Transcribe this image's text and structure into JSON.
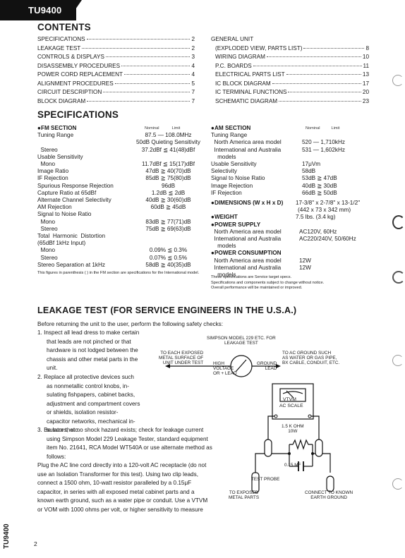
{
  "header": {
    "model_tab": "TU9400"
  },
  "contents": {
    "title": "CONTENTS",
    "left": [
      {
        "label": "SPECIFICATIONS",
        "page": "2"
      },
      {
        "label": "LEAKAGE TEST",
        "page": "2"
      },
      {
        "label": "CONTROLS & DISPLAYS",
        "page": "3"
      },
      {
        "label": "DISASSEMBLY PROCEDURES",
        "page": "4"
      },
      {
        "label": "POWER CORD REPLACEMENT",
        "page": "4"
      },
      {
        "label": "ALIGNMENT PROCEDURES",
        "page": "5"
      },
      {
        "label": "CIRCUIT DESCRIPTION",
        "page": "7"
      },
      {
        "label": "BLOCK DIAGRAM",
        "page": "7"
      }
    ],
    "right_first_line": "GENERAL UNIT",
    "right": [
      {
        "label": "(EXPLODED VIEW, PARTS LIST)",
        "page": "8"
      },
      {
        "label": "WIRING DIAGRAM",
        "page": "10"
      },
      {
        "label": "P.C. BOARDS",
        "page": "11"
      },
      {
        "label": "ELECTRICAL PARTS LIST",
        "page": "13"
      },
      {
        "label": "IC BLOCK DIAGRAM",
        "page": "17"
      },
      {
        "label": "IC TERMINAL FUNCTIONS",
        "page": "20"
      },
      {
        "label": "SCHEMATIC DIAGRAM",
        "page": "23"
      }
    ]
  },
  "specifications": {
    "title": "SPECIFICATIONS",
    "col_nominal": "Nominal",
    "col_limit": "Limit",
    "fm": {
      "title": "●FM SECTION",
      "rows": [
        {
          "k": "Tuning Range",
          "v": "87.5 — 108.0MHz"
        },
        {
          "k": "",
          "v": "50dB Quieting Sensitivity"
        },
        {
          "k": "  Stereo",
          "v": "37.2dBf ≦ 41(48)dBf"
        },
        {
          "k": "Usable Sensitivity",
          "v": ""
        },
        {
          "k": "  Mono",
          "v": "11.7dBf ≦ 15(17)dBf"
        },
        {
          "k": "Image Ratio",
          "v": "47dB ≧ 40(70)dB"
        },
        {
          "k": "IF Rejection",
          "v": "85dB ≧ 75(80)dB"
        },
        {
          "k": "Spurious Response Rejection",
          "v": "96dB"
        },
        {
          "k": "Capture Ratio at 65dBf",
          "v": "1.2dB ≦ 2dB"
        },
        {
          "k": "Alternate Channel Selectivity",
          "v": "40dB ≧ 30(60)dB"
        },
        {
          "k": "AM Rejection",
          "v": "60dB ≧ 45dB"
        },
        {
          "k": "Signal to Noise Ratio",
          "v": ""
        },
        {
          "k": "  Mono",
          "v": "83dB ≧ 77(71)dB"
        },
        {
          "k": "  Stereo",
          "v": "75dB ≧ 69(63)dB"
        },
        {
          "k": "Total  Harmonic  Distortion",
          "v": ""
        },
        {
          "k": "(65dBf 1kHz Input)",
          "v": ""
        },
        {
          "k": "  Mono",
          "v": "0.09% ≦ 0.3%"
        },
        {
          "k": "  Stereo",
          "v": "0.07% ≦ 0.5%"
        },
        {
          "k": "Stereo Separation at 1kHz",
          "v": "58dB ≧ 40(35)dB"
        }
      ],
      "note": "This figures in parenthesis (   ) in the FM section are specifications for the International model."
    },
    "am": {
      "title": "●AM SECTION",
      "rows": [
        {
          "k": "Tuning Range",
          "v": ""
        },
        {
          "k": "  North America area model",
          "v": "520 — 1,710kHz"
        },
        {
          "k": "  International and Australia",
          "v": "531 — 1,602kHz"
        },
        {
          "k": "    models",
          "v": ""
        },
        {
          "k": "Usable Sensitivity",
          "v": "17μVm"
        },
        {
          "k": "Selectivity",
          "v": "58dB"
        },
        {
          "k": "Signal to Noise Ratio",
          "v": "53dB ≧ 47dB"
        },
        {
          "k": "Image Rejection",
          "v": "40dB ≧ 30dB"
        },
        {
          "k": "IF Rejection",
          "v": "66dB ≧ 50dB"
        }
      ]
    },
    "dimensions": {
      "title": "●DIMENSIONS (W x H x D)",
      "line1": "17-3/8\" x 2-7/8\" x 13-1/2\"",
      "line2": "(442 x 73 x 342 mm)"
    },
    "weight": {
      "title": "●WEIGHT",
      "value": "7.5 lbs. (3.4 kg)"
    },
    "power_supply": {
      "title": "●POWER SUPPLY",
      "rows": [
        {
          "k": "  North America area model",
          "v": "AC120V, 60Hz"
        },
        {
          "k": "  International and Australia",
          "v": "AC220/240V, 50/60Hz"
        },
        {
          "k": "    models",
          "v": ""
        }
      ]
    },
    "power_consumption": {
      "title": "●POWER CONSUMPTION",
      "rows": [
        {
          "k": "  North America area model",
          "v": "12W"
        },
        {
          "k": "  International and Australia",
          "v": "12W"
        },
        {
          "k": "    models",
          "v": ""
        }
      ]
    },
    "service_note": [
      "These specifications are Service target specs.",
      "Specifications and components subject to change without notice.",
      "Overall performance will be maintained or improved."
    ]
  },
  "leakage": {
    "title": "LEAKAGE TEST (FOR SERVICE ENGINEERS IN THE U.S.A.)",
    "intro": "Before returning the unit to the user, perform the following safety checks:",
    "item1": [
      "1.  Inspect all lead dress to make certain",
      "that leads are not pinched or that",
      "hardware is not lodged between the",
      "chassis and other metal parts in the",
      "unit."
    ],
    "item2": [
      "2.  Replace all protective devices such",
      "as nonmetallic control knobs, in-",
      "sulating fishpapers, cabinet backs,",
      "adjustment and compartment covers",
      "or  shields,  isolation  resistor-",
      "capacitor networks, mechanical in-",
      "sulators, etc."
    ],
    "item3": [
      "3.  Be sure that no shock hazard exists; check for leakage current",
      "using Simpson Model 229 Leakage Tester, standard equipment",
      "item No. 21641, RCA Model WT540A or use alternate method as",
      "follows:"
    ],
    "para": [
      "Plug the AC line cord directly into a 120-volt AC receptacle (do not",
      "use an Isolation Transformer for this test). Using two clip leads,",
      "connect a 1500 ohm, 10-watt resistor paralleled by a 0.15μF",
      "capacitor, in series with all exposed metal cabinet parts and a",
      "known earth ground, such as a water pipe or conduit. Use a VTVM",
      "or VOM with 1000 ohms per volt, or higher sensitivity to measure"
    ],
    "diagram": {
      "simpson_label": [
        "SIMPSON MODEL 229 ETC. FOR",
        "LEAKAGE TEST"
      ],
      "left_label": [
        "TO EACH EXPOSED",
        "METAL SURFACE OF",
        "UNIT UNDER TEST"
      ],
      "right_label": [
        "TO AC GROUND SUCH",
        "AS WATER OR GAS PIPE,",
        "BX CABLE, CONDUIT, ETC."
      ],
      "high_lead": [
        "HIGH",
        "VOLTAGE",
        "OR  + LEAD"
      ],
      "ground_lead": [
        "GROUND",
        "LEAD"
      ],
      "vtvm": "VTVM",
      "ac_scale": "AC SCALE",
      "resistor": [
        "1.5 K OHM",
        "10W"
      ],
      "capacitor": "0.15 MF",
      "test_probe": "TEST PROBE",
      "exposed": [
        "TO EXPOSED",
        "METAL PARTS"
      ],
      "earth": [
        "CONNECT TO KNOWN",
        "EARTH GROUND"
      ]
    }
  },
  "footer": {
    "page_number": "2",
    "side_code": "TU9400"
  }
}
